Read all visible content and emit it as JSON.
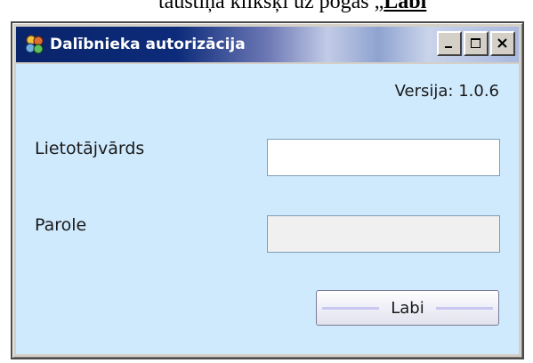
{
  "caption": {
    "text": "taustiņa klikšķi uz pogas „",
    "bold": "Labi"
  },
  "window": {
    "title": "Dalībnieka autorizācija",
    "icon": "app-puzzle-icon",
    "controls": {
      "minimize": "minimize-icon",
      "maximize": "maximize-icon",
      "close": "close-icon"
    }
  },
  "form": {
    "version": "Versija: 1.0.6",
    "username_label": "Lietotājvārds",
    "username_value": "",
    "password_label": "Parole",
    "password_value": "",
    "ok_button": "Labi"
  },
  "colors": {
    "client_bg": "#cfeafd",
    "title_dark": "#0a246a",
    "frame": "#d4d0c8"
  }
}
